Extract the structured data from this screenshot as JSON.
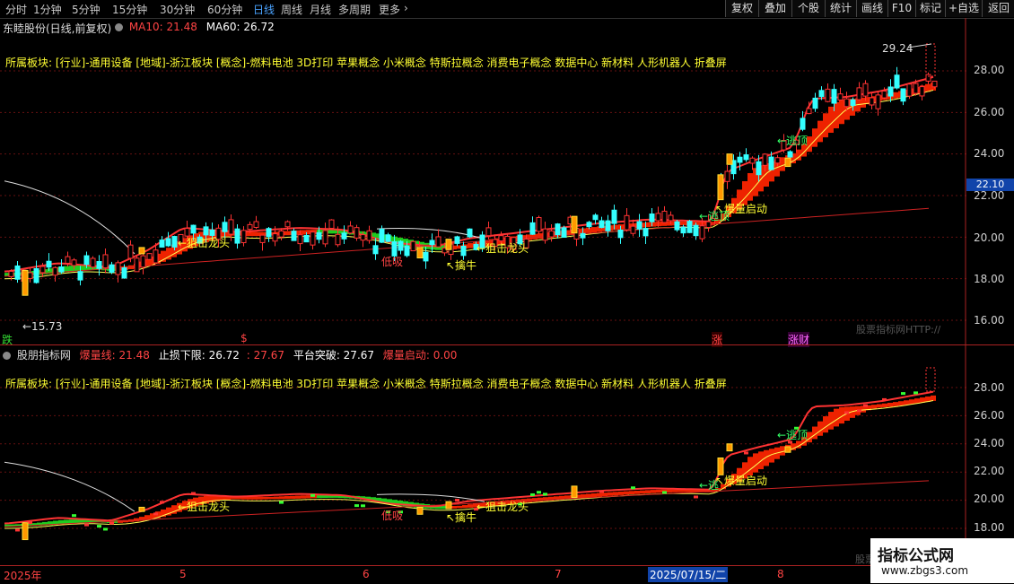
{
  "toolbar": {
    "periods": [
      "分时",
      "1分钟",
      "5分钟",
      "15分钟",
      "30分钟",
      "60分钟",
      "日线",
      "周线",
      "月线",
      "多周期",
      "更多"
    ],
    "active_period": "日线",
    "more_arrow": "›",
    "right_buttons": [
      "复权",
      "叠加",
      "个股",
      "统计",
      "画线",
      "F10",
      "标记",
      "+自选",
      "返回"
    ]
  },
  "main_panel": {
    "stock_title": "东睦股份(日线,前复权)",
    "ma10_label": "MA10: 21.48",
    "ma60_label": "MA60: 26.72",
    "sector_text": "所属板块: [行业]-通用设备 [地域]-浙江板块 [概念]-燃料电池 3D打印 苹果概念 小米概念 特斯拉概念 消费电子概念 数据中心 新材料 人形机器人 折叠屏",
    "high_label": "29.24",
    "low_label": "←15.73",
    "current_price_tag": "22.10",
    "y_ticks": [
      "28.00",
      "26.00",
      "24.00",
      "22.00",
      "20.00",
      "18.00",
      "16.00"
    ],
    "annotations": [
      "←狙击龙头",
      "低吸",
      "↖擒牛",
      "←狙击龙头",
      "↖爆量启动",
      "←逃顶",
      "←逃顶"
    ],
    "bottom_markers": [
      {
        "text": "跌",
        "color": "#33dd33"
      },
      {
        "text": "$",
        "color": "#ff4444"
      },
      {
        "text": "涨",
        "color": "#ff4444"
      },
      {
        "text": "涨财",
        "color": "#ff66ff"
      }
    ],
    "watermark": "股票指标网HTTP://"
  },
  "sub_panel": {
    "title": "股朋指标网",
    "burst_line_label": "爆量线: 21.48",
    "stop_loss_label": "止损下限: 26.72",
    "sep_value": ": 27.67",
    "platform_label": "平台突破: 27.67",
    "burst_start_label": "爆量启动: 0.00",
    "sector_text": "所属板块: [行业]-通用设备 [地域]-浙江板块 [概念]-燃料电池 3D打印 苹果概念 小米概念 特斯拉概念 消费电子概念 数据中心 新材料 人形机器人 折叠屏",
    "y_ticks": [
      "28.00",
      "26.00",
      "24.00",
      "22.00",
      "20.00",
      "18.00"
    ],
    "annotations": [
      "←狙击龙头",
      "低吸",
      "↖擒牛",
      "←狙击龙头",
      "↖爆量启动",
      "←逃顶",
      "←逃"
    ],
    "watermark": "股票"
  },
  "time_axis": {
    "labels": [
      "2025年",
      "5",
      "6",
      "7",
      "2025/07/15/二",
      "8"
    ]
  },
  "brand": {
    "name": "指标公式网",
    "url": "www.zbgs3.com"
  },
  "colors": {
    "up": "#ff3333",
    "down": "#33ffff",
    "green_band": "#22dd22",
    "red_band": "#ff2200",
    "yellow": "#ffff33",
    "accent": "#4aa3ff"
  }
}
